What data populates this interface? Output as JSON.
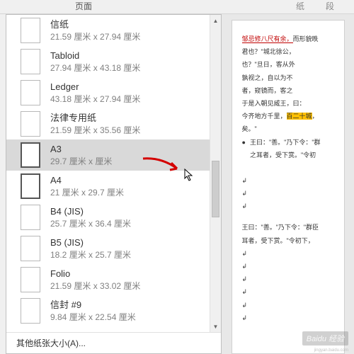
{
  "ribbon": {
    "page": "页面",
    "paper_char": "纸",
    "paragraph": "段"
  },
  "sizes": [
    {
      "name": "信纸",
      "dims": "21.59 厘米 x 27.94 厘米",
      "sel": false,
      "hl": false
    },
    {
      "name": "Tabloid",
      "dims": "27.94 厘米 x 43.18 厘米",
      "sel": false,
      "hl": false
    },
    {
      "name": "Ledger",
      "dims": "43.18 厘米 x 27.94 厘米",
      "sel": false,
      "hl": false
    },
    {
      "name": "法律专用纸",
      "dims": "21.59 厘米 x 35.56 厘米",
      "sel": false,
      "hl": false
    },
    {
      "name": "A3",
      "dims": "29.7 厘米 x     厘米",
      "sel": true,
      "hl": true
    },
    {
      "name": "A4",
      "dims": "21 厘米 x 29.7 厘米",
      "sel": true,
      "hl": false
    },
    {
      "name": "B4 (JIS)",
      "dims": "25.7 厘米 x 36.4 厘米",
      "sel": false,
      "hl": false
    },
    {
      "name": "B5 (JIS)",
      "dims": "18.2 厘米 x 25.7 厘米",
      "sel": false,
      "hl": false
    },
    {
      "name": "Folio",
      "dims": "21.59 厘米 x 33.02 厘米",
      "sel": false,
      "hl": false
    },
    {
      "name": "信封 #9",
      "dims": "9.84 厘米 x 22.54 厘米",
      "sel": false,
      "hl": false
    }
  ],
  "other_sizes": "其他纸张大小(A)...",
  "doc": {
    "l1a": "邹忌修八尺有余，",
    "l1b": "而形貌昳",
    "l2": "君也？\"城北徐公，",
    "l3": "也？\"旦日，客从外",
    "l4": "孰视之，自以为不",
    "l5": "者，窥镜而，客之",
    "l6": "于是入朝见威王，曰：",
    "l7a": "今齐地方千里，",
    "l7b": "百二十城",
    "l7c": "，",
    "l8": "矣。\"",
    "l9": "王曰：\"善。\"乃下令：\"群",
    "l10": "之耳者，受下赏。\"令初",
    "l11": "王曰：\"善。\"乃下令：\"群臣",
    "l12": "耳者，受下赏。\"令初下，"
  },
  "watermark": "Baidu 经验",
  "watermark_sub": "jingyan.baidu.com"
}
